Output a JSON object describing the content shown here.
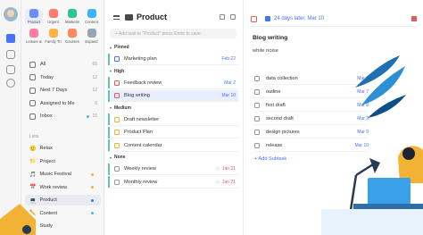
{
  "rail": {
    "icons": [
      "check-square-icon",
      "calendar-icon",
      "grid-icon",
      "clock-icon",
      "search-icon",
      "settings-icon",
      "bell-icon"
    ]
  },
  "apps": [
    {
      "label": "Product",
      "icon": "folder-icon",
      "color": "#6b8cff",
      "selected": true
    },
    {
      "label": "Urgent",
      "icon": "bolt-icon",
      "color": "#ff7b6b"
    },
    {
      "label": "Marketin",
      "icon": "megaphone-icon",
      "color": "#2fc58f"
    },
    {
      "label": "Content",
      "icon": "document-icon",
      "color": "#3ab4ff"
    },
    {
      "label": "Leisure &",
      "icon": "couch-icon",
      "color": "#ff7aa8"
    },
    {
      "label": "Family Tri",
      "icon": "car-icon",
      "color": "#ffb347"
    },
    {
      "label": "Courses",
      "icon": "book-icon",
      "color": "#ff8a5c"
    },
    {
      "label": "Expand",
      "icon": "expand-icon",
      "color": "#9aa4b8"
    }
  ],
  "smart_lists": [
    {
      "label": "All",
      "count": "65"
    },
    {
      "label": "Today",
      "count": "12"
    },
    {
      "label": "Next 7 Days",
      "count": "12"
    },
    {
      "label": "Assigned to Me",
      "count": "6"
    },
    {
      "label": "Inbox",
      "count": "15",
      "dot": "#4fb6e8"
    }
  ],
  "lists_header": "Lists",
  "lists": [
    {
      "label": "Relax",
      "emoji": "🙂"
    },
    {
      "label": "Project",
      "emoji": "📁"
    },
    {
      "label": "Music Festival",
      "emoji": "🎵",
      "dot": "#f2b233"
    },
    {
      "label": "Work review",
      "emoji": "📅",
      "dot": "#f2b233"
    },
    {
      "label": "Product",
      "emoji": "💻",
      "dot": "#4772fa",
      "selected": true
    },
    {
      "label": "Content",
      "emoji": "✏️",
      "dot": "#4fb6e8"
    },
    {
      "label": "Study",
      "emoji": "📚"
    }
  ],
  "main": {
    "title": "Product",
    "add_placeholder": "+ Add task to \"Product\" press Enter to save",
    "sections": [
      {
        "name": "Pinned",
        "tasks": [
          {
            "title": "Marketing plan",
            "date": "Feb 22",
            "date_color": "blue",
            "check": "blue"
          }
        ]
      },
      {
        "name": "High",
        "tasks": [
          {
            "title": "Feedback review",
            "date": "Mar 2",
            "date_color": "blue",
            "check": "red"
          },
          {
            "title": "Blog writing",
            "date": "Mar 10",
            "date_color": "blue",
            "check": "red",
            "selected": true
          }
        ]
      },
      {
        "name": "Medium",
        "tasks": [
          {
            "title": "Draft newsletter",
            "date": "",
            "check": "yellow"
          },
          {
            "title": "Product Plan",
            "date": "",
            "check": "yellow"
          },
          {
            "title": "Content calendar",
            "date": "",
            "check": "yellow"
          }
        ]
      },
      {
        "name": "None",
        "tasks": [
          {
            "title": "Weekly review",
            "date": "Jan 21",
            "date_color": "red",
            "check": "gray"
          },
          {
            "title": "Monthly review",
            "date": "Jan 21",
            "date_color": "red",
            "check": "gray"
          }
        ]
      }
    ]
  },
  "detail": {
    "due": "24 days later, Mar 10",
    "title": "Blog writing",
    "note": "white noise",
    "subtasks": [
      {
        "title": "data collection",
        "date": "Mar 6"
      },
      {
        "title": "outline",
        "date": "Mar 7"
      },
      {
        "title": "first draft",
        "date": "Mar 8"
      },
      {
        "title": "second draft",
        "date": "Mar 9"
      },
      {
        "title": "design pictures",
        "date": "Mar 9"
      },
      {
        "title": "release",
        "date": "Mar 10"
      }
    ],
    "add_subtask": "+ Add Subtask"
  },
  "colors": {
    "accent": "#4772fa",
    "high": "#e25b5b",
    "medium": "#f2b233",
    "list_bar": "#5fc6b3"
  }
}
